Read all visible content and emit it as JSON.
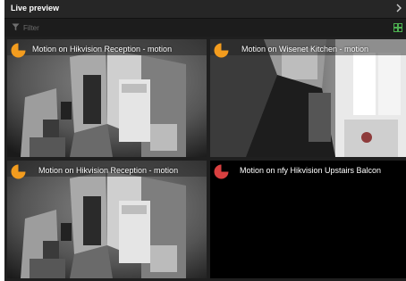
{
  "panel": {
    "title": "Live preview"
  },
  "filter": {
    "placeholder": "Filter"
  },
  "colors": {
    "motion_warn": "#f39c1e",
    "motion_alert": "#d94040",
    "grid_icon": "#4caf50"
  },
  "tiles": [
    {
      "label": "Motion on Hikvision Reception - motion",
      "indicator": "pie-icon-orange",
      "feed": "living-room"
    },
    {
      "label": "Motion on Wisenet Kitchen - motion",
      "indicator": "pie-icon-orange",
      "feed": "kitchen"
    },
    {
      "label": "Motion on Hikvision Reception - motion",
      "indicator": "pie-icon-orange",
      "feed": "living-room"
    },
    {
      "label": "Motion on nfy Hikvision Upstairs Balcon",
      "indicator": "pie-icon-red",
      "feed": "no-signal"
    }
  ]
}
